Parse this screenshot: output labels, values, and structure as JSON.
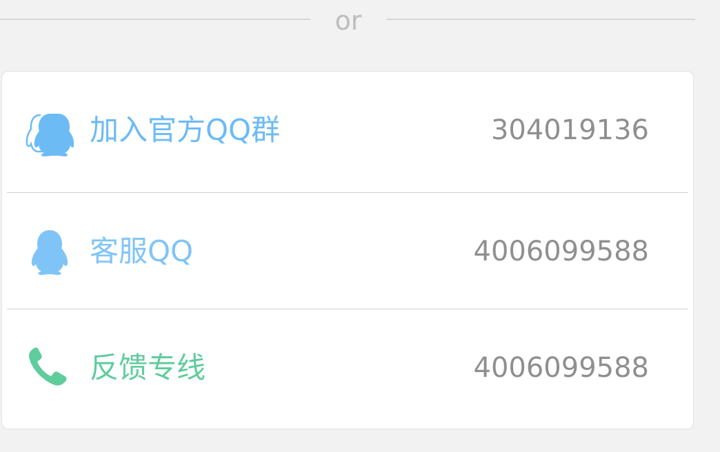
{
  "divider": {
    "text": "or"
  },
  "colors": {
    "qq_blue": "#6cbbf5",
    "qq_light_blue": "#80c4f7",
    "phone_green": "#5fcc9c",
    "number_gray": "#8f8f8f"
  },
  "contacts": [
    {
      "label": "加入官方QQ群",
      "value": "304019136",
      "icon": "qq-group-icon",
      "color": "#6cbbf5"
    },
    {
      "label": "客服QQ",
      "value": "4006099588",
      "icon": "qq-icon",
      "color": "#80c4f7"
    },
    {
      "label": "反馈专线",
      "value": "4006099588",
      "icon": "phone-icon",
      "color": "#5fcc9c"
    }
  ]
}
